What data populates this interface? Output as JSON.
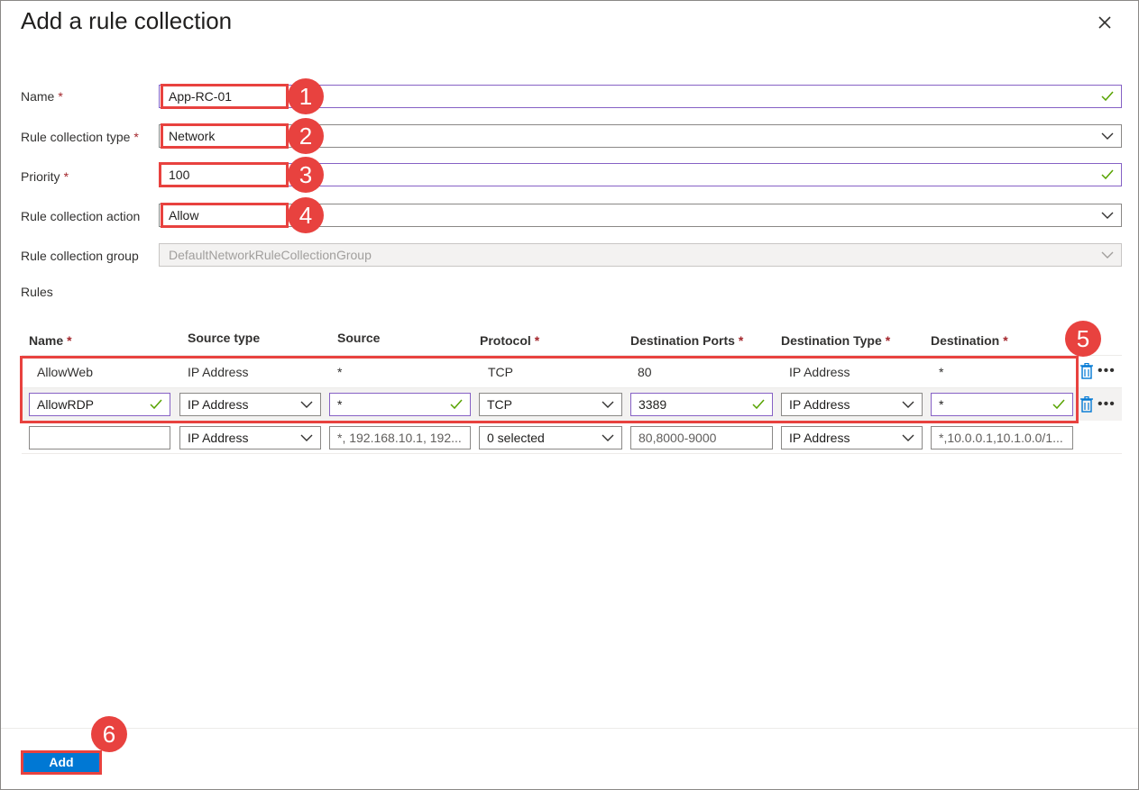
{
  "dialog": {
    "title": "Add a rule collection"
  },
  "form": {
    "name_label": "Name",
    "name_value": "App-RC-01",
    "type_label": "Rule collection type",
    "type_value": "Network",
    "priority_label": "Priority",
    "priority_value": "100",
    "action_label": "Rule collection action",
    "action_value": "Allow",
    "group_label": "Rule collection group",
    "group_value": "DefaultNetworkRuleCollectionGroup",
    "required_mark": "*"
  },
  "rules": {
    "section_label": "Rules",
    "headers": {
      "name": "Name",
      "source_type": "Source type",
      "source": "Source",
      "protocol": "Protocol",
      "destination_ports": "Destination Ports",
      "destination_type": "Destination Type",
      "destination": "Destination"
    },
    "rows": [
      {
        "name": "AllowWeb",
        "source_type": "IP Address",
        "source": "*",
        "protocol": "TCP",
        "destination_ports": "80",
        "destination_type": "IP Address",
        "destination": "*"
      },
      {
        "name": "AllowRDP",
        "source_type": "IP Address",
        "source": "*",
        "protocol": "TCP",
        "destination_ports": "3389",
        "destination_type": "IP Address",
        "destination": "*"
      }
    ],
    "new_row": {
      "name": "",
      "source_type": "IP Address",
      "source_placeholder": "*, 192.168.10.1, 192...",
      "protocol": "0 selected",
      "ports_placeholder": "80,8000-9000",
      "destination_type": "IP Address",
      "destination_placeholder": "*,10.0.0.1,10.1.0.0/1..."
    }
  },
  "callouts": [
    "1",
    "2",
    "3",
    "4",
    "5",
    "6"
  ],
  "footer": {
    "add_label": "Add"
  },
  "colors": {
    "accent": "#0078d4",
    "highlight": "#e8423f",
    "valid_border": "#8661c5",
    "check": "#57a300",
    "required": "#a4262c"
  },
  "icons": {
    "close": "close-icon",
    "check": "checkmark-icon",
    "chevron": "chevron-down-icon",
    "trash": "trash-icon",
    "more": "more-icon"
  }
}
